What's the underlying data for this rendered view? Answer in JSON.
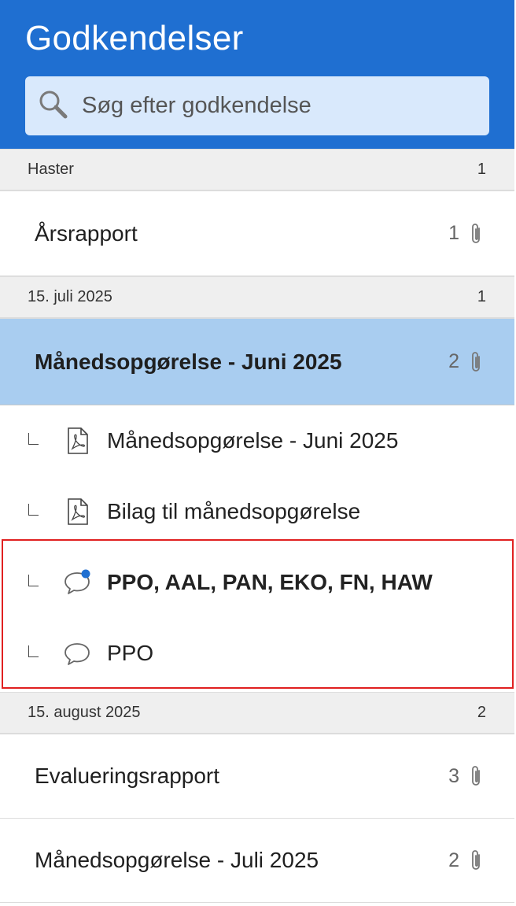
{
  "header": {
    "title": "Godkendelser",
    "search": {
      "placeholder": "Søg efter godkendelse",
      "icon": "search-icon"
    }
  },
  "groups": [
    {
      "label": "Haster",
      "count": "1",
      "items": [
        {
          "title": "Årsrapport",
          "attachments": "1",
          "icon": "paperclip-icon"
        }
      ]
    },
    {
      "label": "15. juli 2025",
      "count": "1",
      "items": [
        {
          "title": "Månedsopgørelse - Juni 2025",
          "attachments": "2",
          "selected": true,
          "children": [
            {
              "label": "Månedsopgørelse - Juni 2025",
              "icon": "pdf-icon"
            },
            {
              "label": "Bilag til månedsopgørelse",
              "icon": "pdf-icon"
            },
            {
              "label": "PPO, AAL, PAN, EKO, FN, HAW",
              "icon": "comment-unread-icon",
              "unread": true
            },
            {
              "label": "PPO",
              "icon": "comment-icon"
            }
          ]
        }
      ]
    },
    {
      "label": "15. august 2025",
      "count": "2",
      "items": [
        {
          "title": "Evalueringsrapport",
          "attachments": "3"
        },
        {
          "title": "Månedsopgørelse - Juli 2025",
          "attachments": "2"
        }
      ]
    }
  ],
  "colors": {
    "header_bg": "#1f6fd1",
    "search_bg": "#d9e9fc",
    "selected_bg": "#a9cdf0",
    "group_bg": "#efefef",
    "highlight_border": "#e02020",
    "unread_dot": "#1f6fd1"
  }
}
